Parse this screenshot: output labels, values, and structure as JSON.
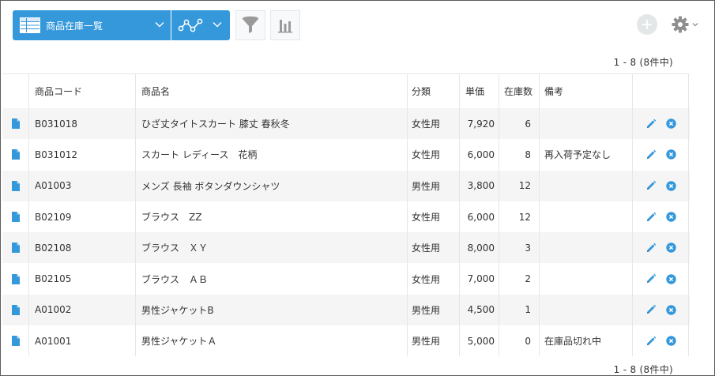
{
  "toolbar": {
    "view_select_label": "商品在庫一覧",
    "view_icon": "table-icon",
    "graph_icon": "graph-icon",
    "filter_icon": "filter-icon",
    "chart_icon": "bar-chart-icon",
    "add_icon": "plus-icon",
    "settings_icon": "gear-icon",
    "accent_color": "#3498db"
  },
  "pagination": {
    "top": "1 - 8  (8件中)",
    "bottom": "1 - 8  (8件中)"
  },
  "table": {
    "headers": [
      "商品コード",
      "商品名",
      "分類",
      "単価",
      "在庫数",
      "備考"
    ],
    "rows": [
      {
        "code": "B031018",
        "name": "ひざ丈タイトスカート 膝丈 春秋冬",
        "category": "女性用",
        "price": "7,920",
        "stock": "6",
        "note": ""
      },
      {
        "code": "B031012",
        "name": "スカート レディース　花柄",
        "category": "女性用",
        "price": "6,000",
        "stock": "8",
        "note": "再入荷予定なし"
      },
      {
        "code": "A01003",
        "name": "メンズ 長袖 ボタンダウンシャツ",
        "category": "男性用",
        "price": "3,800",
        "stock": "12",
        "note": ""
      },
      {
        "code": "B02109",
        "name": "ブラウス　ZZ",
        "category": "女性用",
        "price": "6,000",
        "stock": "12",
        "note": ""
      },
      {
        "code": "B02108",
        "name": "ブラウス　ＸＹ",
        "category": "女性用",
        "price": "8,000",
        "stock": "3",
        "note": ""
      },
      {
        "code": "B02105",
        "name": "ブラウス　ＡＢ",
        "category": "女性用",
        "price": "7,000",
        "stock": "2",
        "note": ""
      },
      {
        "code": "A01002",
        "name": "男性ジャケットB",
        "category": "男性用",
        "price": "4,500",
        "stock": "1",
        "note": ""
      },
      {
        "code": "A01001",
        "name": "男性ジャケットＡ",
        "category": "男性用",
        "price": "5,000",
        "stock": "0",
        "note": "在庫品切れ中"
      }
    ]
  }
}
